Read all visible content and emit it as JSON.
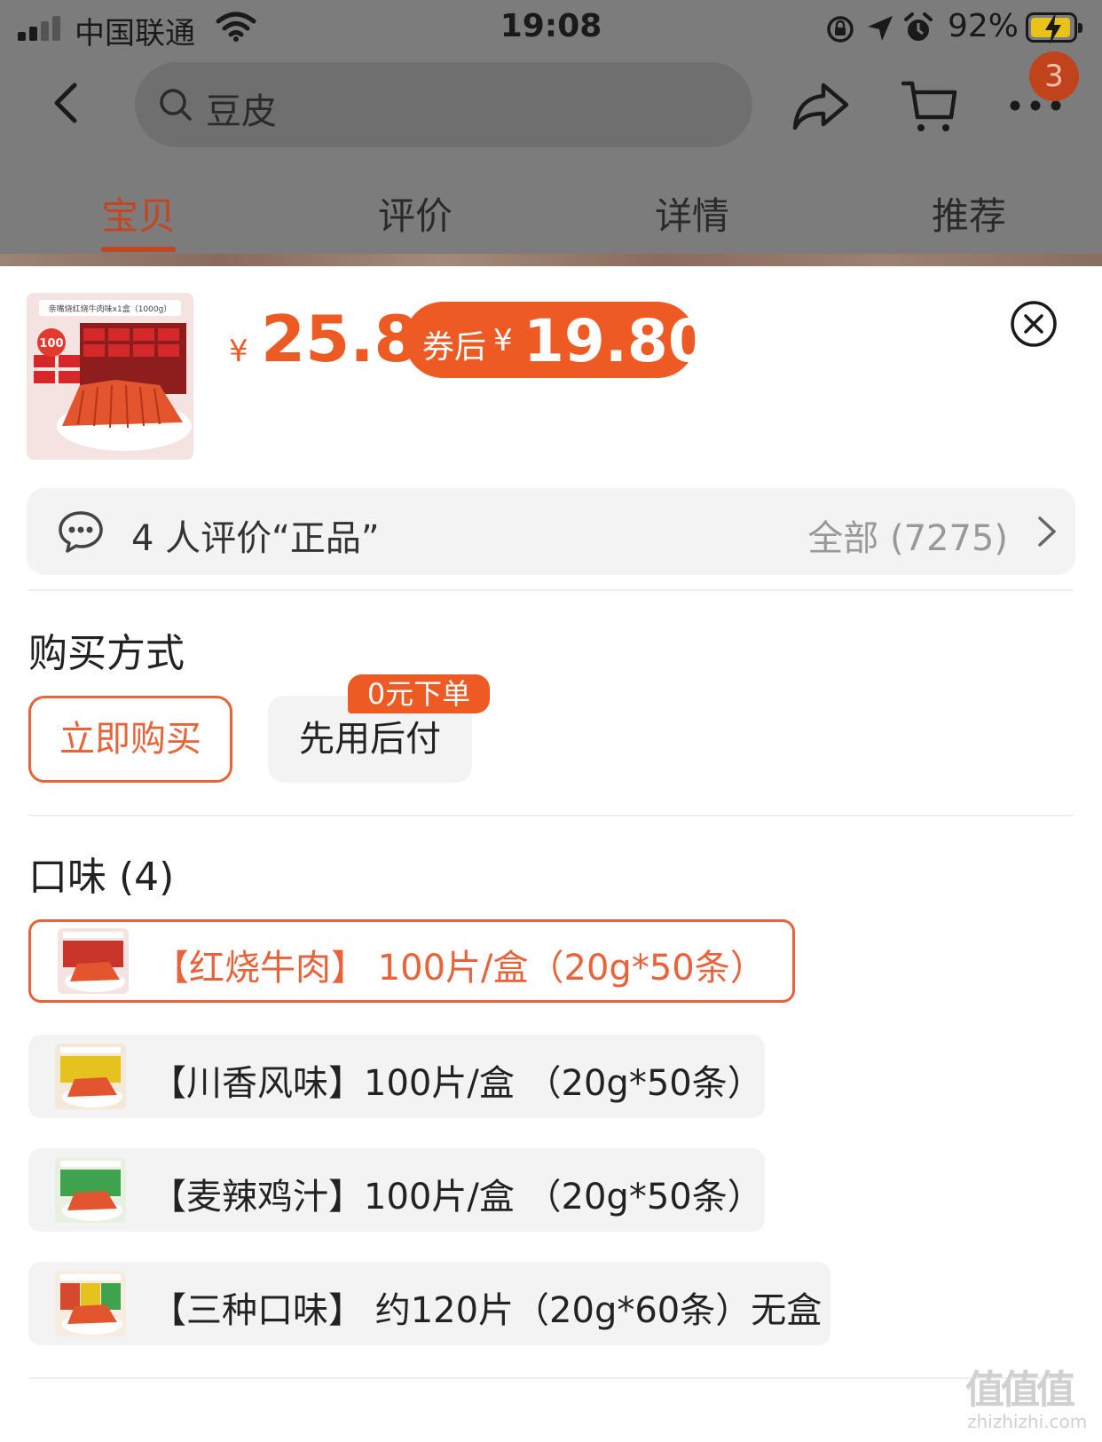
{
  "status_bar": {
    "carrier": "中国联通",
    "time": "19:08",
    "battery_percent": "92%"
  },
  "nav": {
    "search_query": "豆皮",
    "cart_badge_count": "3",
    "icons": [
      "back-icon",
      "search-icon",
      "share-icon",
      "cart-icon",
      "more-icon"
    ]
  },
  "tabs": [
    {
      "label": "宝贝",
      "active": true
    },
    {
      "label": "评价",
      "active": false
    },
    {
      "label": "详情",
      "active": false
    },
    {
      "label": "推荐",
      "active": false
    }
  ],
  "product": {
    "thumbnail_badge": "100",
    "thumbnail_caption": "亲嘴烧红烧牛肉味x1盒（1000g）",
    "currency_symbol": "¥",
    "price": "25.8",
    "coupon_label": "券后",
    "coupon_currency": "¥",
    "coupon_price": "19.80"
  },
  "review_bar": {
    "text": "4 人评价“正品”",
    "all_label": "全部 (7275)"
  },
  "purchase": {
    "title": "购买方式",
    "options": [
      {
        "label": "立即购买",
        "selected": true
      },
      {
        "label": "先用后付",
        "selected": false
      }
    ],
    "badge": "0元下单"
  },
  "flavor": {
    "title": "口味 (4)",
    "options": [
      {
        "label": "【红烧牛肉】 100片/盒（20g*50条）",
        "selected": true,
        "box_color": "#c9352b"
      },
      {
        "label": "【川香风味】100片/盒 （20g*50条）",
        "selected": false,
        "box_color": "#e6c21e"
      },
      {
        "label": "【麦辣鸡汁】100片/盒 （20g*50条）",
        "selected": false,
        "box_color": "#3fa34d"
      },
      {
        "label": "【三种口味】 约120片（20g*60条）无盒",
        "selected": false,
        "box_color": "#d54a2f"
      }
    ]
  },
  "watermark": {
    "text": "值值值",
    "domain": "zhizhizhi.com"
  },
  "colors": {
    "accent": "#ee5a24",
    "accent_border": "#e8623a",
    "tab_active": "#c4461f",
    "overlay": "#7c7c7c"
  }
}
